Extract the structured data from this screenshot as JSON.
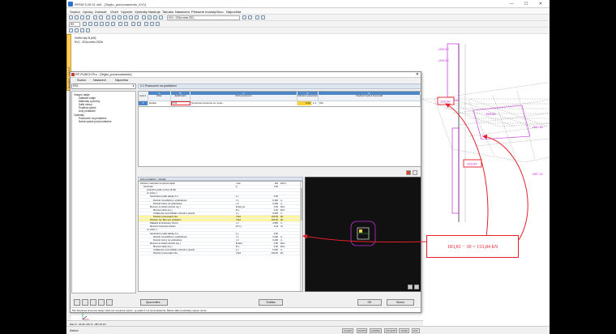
{
  "app": {
    "title": "RFEM 5.25.01 x64 - [Teglio_punzonamento_KV1]",
    "menu": [
      "Soubor",
      "Úpravy",
      "Zobrazit",
      "Vložit",
      "Výpočet",
      "Výsledky",
      "Nástroje",
      "Tabulka",
      "Nastavení",
      "Přídavné moduly",
      "Okno",
      "Nápověda"
    ],
    "toolbar": {
      "loadcase_field": "KV1 : ZS1a nebo ZS2...",
      "small_field": "RS"
    }
  },
  "navigator_tab": "Navigátor - Zobrazit",
  "viewport": {
    "info_line1": "Vnitřní síly N (kN)",
    "info_line2": "KV1 : ZS1a nebo ZS2b",
    "labels": {
      "top": "-200.00",
      "top2": "-200.00",
      "mid": "-163.84",
      "mid_right": "-087.15",
      "boxed_top": "-200.00",
      "boxed_bottom": "-163.84",
      "bottom_right": "-087.15"
    }
  },
  "statusbar": {
    "coords": "Max N: -30.36, Min N: -087.15 kN",
    "bottom_left": "Hotovo",
    "toggles": [
      "UCHOP",
      "RASTR",
      "KARTEZ",
      "OUCHOP",
      "VLINIE",
      "DXF"
    ]
  },
  "dialog": {
    "title": "RF-PUNCH Pro - [Teglio_punzonamento]",
    "menu": [
      "Soubor",
      "Nastavení",
      "Nápověda"
    ],
    "combo": "RS1",
    "section_header": "2.1 Posouzení na protlačení",
    "nav": {
      "group1": "Vstupní údaje",
      "items1": [
        "Základní údaje",
        "Materiály a přechy",
        "Další otvory",
        "Podélná výztuž",
        "Uzly protlačení"
      ],
      "group2": "Výsledky",
      "items2": [
        "Posouzení na protlačení",
        "Nutná výztuž proti protlačení"
      ]
    },
    "table": {
      "col_letters": [
        "A",
        "B",
        "C",
        "D",
        "E"
      ],
      "col_labels": [
        "Uzel č.",
        "Dílec",
        "Zatěžování",
        "Druh posouzení",
        "Kritérium posouzení",
        "Chybová zpráva Komentář"
      ],
      "row": {
        "num": "1",
        "member": "Deska",
        "loading": "CO1",
        "type": "Smyková únosnost ve výstu...",
        "criterion": "0.29",
        "comment": "≤ 1",
        "msg": "511"
      }
    },
    "details_header": "Uzly protlačení - Detaily",
    "details": [
      {
        "label": "Působící maximální smyková napětí",
        "sym": "v Ed",
        "val": "118",
        "unit": "kN/m²",
        "indent": 0,
        "hl": false
      },
      {
        "label": "Součinitel",
        "sym": "β",
        "val": "1.00",
        "unit": "",
        "indent": 1,
        "hl": false
      },
      {
        "label": "podrobné podle rovnice (6.39)",
        "sym": "",
        "val": "",
        "unit": "",
        "indent": 2,
        "hl": false
      },
      {
        "label": "ve směru x",
        "sym": "",
        "val": "",
        "unit": "",
        "indent": 2,
        "hl": false
      },
      {
        "label": "Součinitel k podle tabulky 6.1",
        "sym": "k x",
        "val": "0.60",
        "unit": "",
        "indent": 3,
        "hl": false
      },
      {
        "label": "Rozměr rovnoběžný s výstředností",
        "sym": "c 1",
        "val": "0.400",
        "unit": "m",
        "indent": 4,
        "hl": false
      },
      {
        "label": "Rozměr kolmý na výstřednost",
        "sym": "c 2",
        "val": "0.400",
        "unit": "m",
        "indent": 4,
        "hl": false
      },
      {
        "label": "Moment ve středu obvodu osy x",
        "sym": "M Ed,y,el",
        "val": "0.00",
        "unit": "kNm",
        "indent": 3,
        "hl": false
      },
      {
        "label": "Moment okolo osy y",
        "sym": "M y",
        "val": "0.00",
        "unit": "kNm",
        "indent": 4,
        "hl": false
      },
      {
        "label": "Vzdálenost mezi těžištěm obvodu a působi...",
        "sym": "e y",
        "val": "0.000",
        "unit": "m",
        "indent": 4,
        "hl": false
      },
      {
        "label": "Působící posouvající síla",
        "sym": "V Ed",
        "val": "163.84",
        "unit": "kN",
        "indent": 4,
        "hl": true
      },
      {
        "label": "Rozhod. zat. Bem pro protlačení",
        "sym": "V Ed",
        "val": "153.84",
        "unit": "kN",
        "indent": 3,
        "hl": true
      },
      {
        "label": "Základní kontrolovaný obvod",
        "sym": "u 1",
        "val": "4.550",
        "unit": "m",
        "indent": 3,
        "hl": false
      },
      {
        "label": "Moment únosnosti obvodu",
        "sym": "W 1,x",
        "val": "2.43",
        "unit": "m²",
        "indent": 3,
        "hl": false
      },
      {
        "label": "ve směru y",
        "sym": "",
        "val": "",
        "unit": "",
        "indent": 2,
        "hl": false
      },
      {
        "label": "Součinitel k podle tabulky 6.1",
        "sym": "k y",
        "val": "0.60",
        "unit": "",
        "indent": 3,
        "hl": false
      },
      {
        "label": "Rozměr rovnoběžný s výstředností",
        "sym": "c 1",
        "val": "0.400",
        "unit": "m",
        "indent": 4,
        "hl": false
      },
      {
        "label": "Rozměr kolmý na výstřednost",
        "sym": "c 2",
        "val": "0.400",
        "unit": "m",
        "indent": 4,
        "hl": false
      },
      {
        "label": "Moment ve středu obvodu osy x",
        "sym": "M Ed,x",
        "val": "0.00",
        "unit": "kNm",
        "indent": 3,
        "hl": false
      },
      {
        "label": "Moment okolo osy x",
        "sym": "M x",
        "val": "0.00",
        "unit": "kNm",
        "indent": 4,
        "hl": false
      },
      {
        "label": "Vzdálenost mezi těžištěm obvodu a působi...",
        "sym": "e x",
        "val": "0.000",
        "unit": "m",
        "indent": 4,
        "hl": false
      },
      {
        "label": "Působící posouvající síla",
        "sym": "V Ed",
        "val": "163.84",
        "unit": "kN",
        "indent": 4,
        "hl": false
      }
    ],
    "buttons": {
      "details": "Upozornění...",
      "graphics": "Grafika",
      "ok": "OK",
      "cancel": "Storno"
    },
    "status": "511 Smyková únosnost desky větší než smyková výztuž - je podle 6.4.4 (2) dostatečná. Žádné další prostředky nejsou nutné."
  },
  "callout": {
    "text": "183,81 − 30 = 153,84 kN"
  },
  "colors": {
    "accent_red": "#e3202c",
    "table_blue": "#4a86c8",
    "highlight_yellow": "#fff59a",
    "magenta": "#c42bd8"
  }
}
